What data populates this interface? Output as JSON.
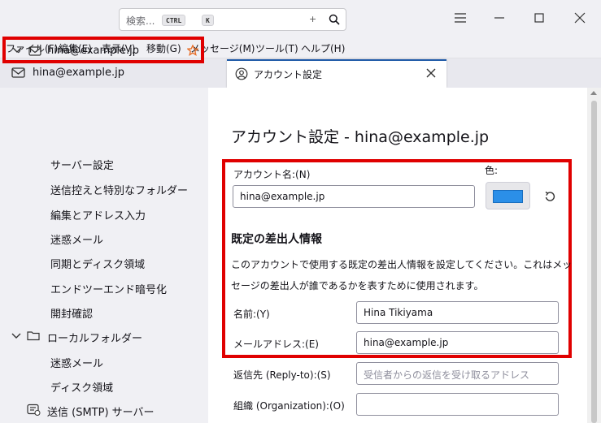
{
  "titlebar": {
    "search_placeholder": "検索...",
    "shortcut_key1": "CTRL",
    "shortcut_plus": "+",
    "shortcut_key2": "K"
  },
  "menubar": {
    "items": [
      "ファイル(F)",
      "編集(E)",
      "表示(V)",
      "移動(G)",
      "メッセージ(M)",
      "ツール(T)",
      "ヘルプ(H)"
    ]
  },
  "tabs": [
    {
      "label": "hina@example.jp"
    },
    {
      "label": "アカウント設定"
    }
  ],
  "sidebar": {
    "account": "hina@example.jp",
    "account_items": [
      "サーバー設定",
      "送信控えと特別なフォルダー",
      "編集とアドレス入力",
      "迷惑メール",
      "同期とディスク領域",
      "エンドツーエンド暗号化",
      "開封確認"
    ],
    "local_folders": "ローカルフォルダー",
    "local_items": [
      "迷惑メール",
      "ディスク領域"
    ],
    "smtp": "送信 (SMTP) サーバー"
  },
  "main": {
    "title": "アカウント設定 - hina@example.jp",
    "account_name_label": "アカウント名:(N)",
    "account_name_value": "hina@example.jp",
    "color_label": "色:",
    "color_value": "#2b8fe8",
    "section_heading": "既定の差出人情報",
    "section_desc": "このアカウントで使用する既定の差出人情報を設定してください。これはメッセージの差出人が誰であるかを表すために使用されます。",
    "name_label": "名前:(Y)",
    "name_value": "Hina Tikiyama",
    "email_label": "メールアドレス:(E)",
    "email_value": "hina@example.jp",
    "replyto_label": "返信先 (Reply-to):(S)",
    "replyto_placeholder": "受信者からの返信を受け取るアドレス",
    "org_label": "組織 (Organization):(O)",
    "org_value": ""
  },
  "colors": {
    "highlight_red": "#e00000",
    "accent_blue": "#1f5aa8",
    "star_orange": "#e8702a"
  }
}
